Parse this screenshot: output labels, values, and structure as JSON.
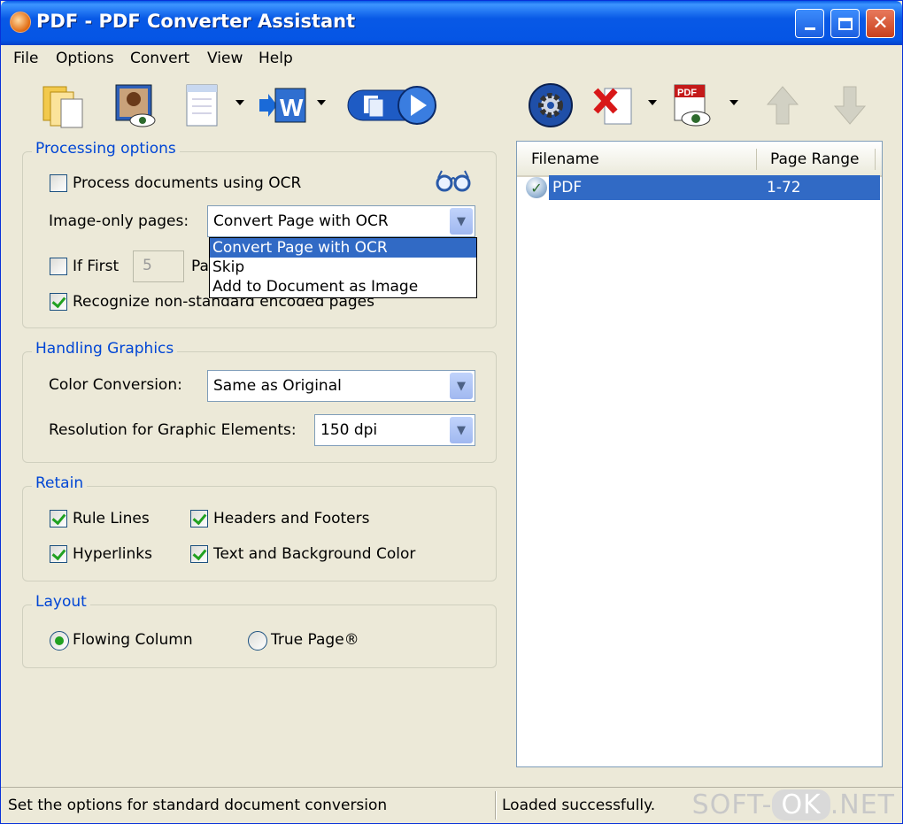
{
  "window": {
    "title": "PDF - PDF Converter Assistant"
  },
  "menu": [
    "File",
    "Options",
    "Convert",
    "View",
    "Help"
  ],
  "toolbar": {
    "tools": [
      "open-files-icon",
      "preview-icon",
      "document-icon",
      "word-export-icon",
      "convert-run-icon",
      "settings-gear-icon",
      "remove-document-icon",
      "pdf-preview-icon",
      "move-up-icon",
      "move-down-icon"
    ]
  },
  "processing": {
    "label": "Processing options",
    "ocr_label": "Process documents using OCR",
    "ocr_checked": false,
    "image_only_label": "Image-only pages:",
    "image_only_value": "Convert Page with OCR",
    "dropdown_options": [
      "Convert Page with OCR",
      "Skip",
      "Add to Document as Image"
    ],
    "if_first_label": "If First",
    "if_first_value": "5",
    "pages_label": "Pa",
    "recognize_label": "Recognize non-standard encoded pages",
    "recognize_checked": true
  },
  "graphics": {
    "label": "Handling Graphics",
    "color_label": "Color Conversion:",
    "color_value": "Same as Original",
    "resolution_label": "Resolution for Graphic Elements:",
    "resolution_value": "150 dpi"
  },
  "retain": {
    "label": "Retain",
    "rule_lines": "Rule Lines",
    "headers_footers": "Headers and Footers",
    "hyperlinks": "Hyperlinks",
    "text_bg": "Text and Background Color"
  },
  "layout": {
    "label": "Layout",
    "flowing": "Flowing Column",
    "true_page": "True Page®",
    "selected": "flowing"
  },
  "files": {
    "col_filename": "Filename",
    "col_range": "Page Range",
    "rows": [
      {
        "name": "PDF",
        "range": "1-72"
      }
    ]
  },
  "status": {
    "left": "Set the options for standard document conversion",
    "right": "Loaded successfully.",
    "watermark_a": "SOFT-",
    "watermark_b": "OK",
    "watermark_c": ".NET"
  }
}
